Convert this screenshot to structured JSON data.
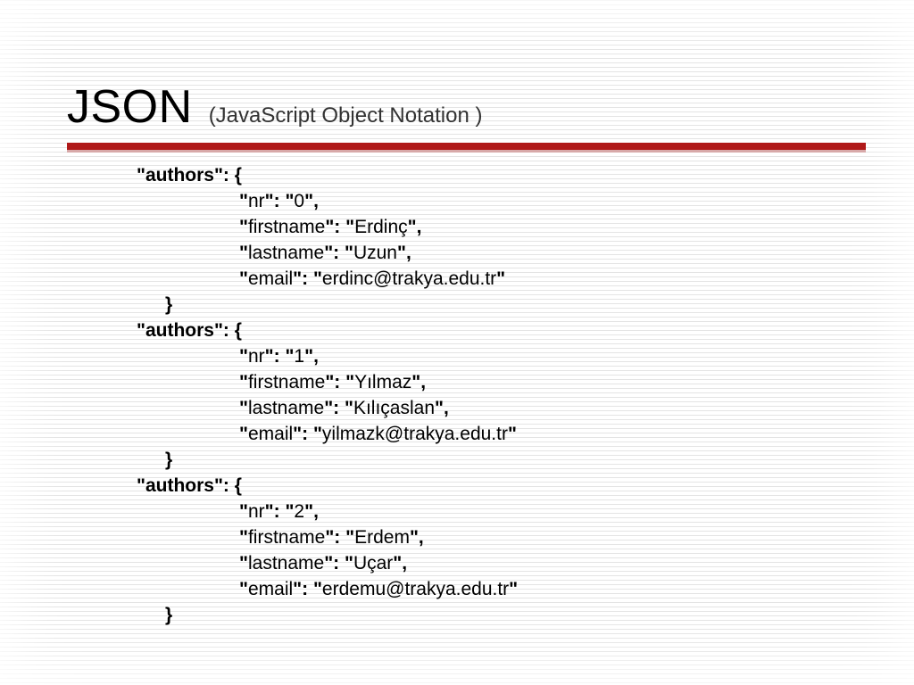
{
  "title": "JSON",
  "subtitle": "(JavaScript Object Notation )",
  "key": "authors",
  "fields": [
    "nr",
    "firstname",
    "lastname",
    "email"
  ],
  "authors": [
    {
      "nr": "0",
      "firstname": "Erdinç",
      "lastname": "Uzun",
      "email": "erdinc@trakya.edu.tr"
    },
    {
      "nr": "1",
      "firstname": "Yılmaz",
      "lastname": "Kılıçaslan",
      "email": "yilmazk@trakya.edu.tr"
    },
    {
      "nr": "2",
      "firstname": "Erdem",
      "lastname": "Uçar",
      "email": "erdemu@trakya.edu.tr"
    }
  ]
}
